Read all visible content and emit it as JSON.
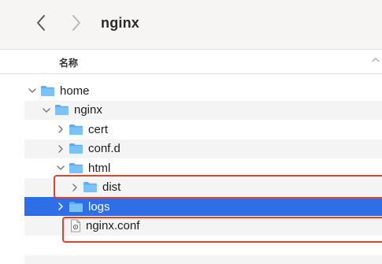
{
  "window": {
    "title": "nginx"
  },
  "toolbar": {
    "back_icon": "chevron-left-icon",
    "forward_icon": "chevron-right-icon"
  },
  "column_header": {
    "name_label": "名称",
    "sort_icon": "chevron-up-icon"
  },
  "tree": [
    {
      "id": "home",
      "label": "home",
      "type": "folder",
      "expanded": true,
      "level": 0
    },
    {
      "id": "nginx",
      "label": "nginx",
      "type": "folder",
      "expanded": true,
      "level": 1
    },
    {
      "id": "cert",
      "label": "cert",
      "type": "folder",
      "expanded": false,
      "level": 2
    },
    {
      "id": "confd",
      "label": "conf.d",
      "type": "folder",
      "expanded": false,
      "level": 2
    },
    {
      "id": "html",
      "label": "html",
      "type": "folder",
      "expanded": true,
      "level": 2
    },
    {
      "id": "dist",
      "label": "dist",
      "type": "folder",
      "expanded": false,
      "level": 3,
      "highlighted": true
    },
    {
      "id": "logs",
      "label": "logs",
      "type": "folder",
      "expanded": false,
      "level": 2,
      "selected": true
    },
    {
      "id": "conf",
      "label": "nginx.conf",
      "type": "file",
      "level": 2,
      "highlighted": true
    }
  ],
  "colors": {
    "selection": "#2e6ee6",
    "folder": "#5aaef0",
    "highlight_border": "#e0412e",
    "alt_row": "#f4f4f4"
  }
}
